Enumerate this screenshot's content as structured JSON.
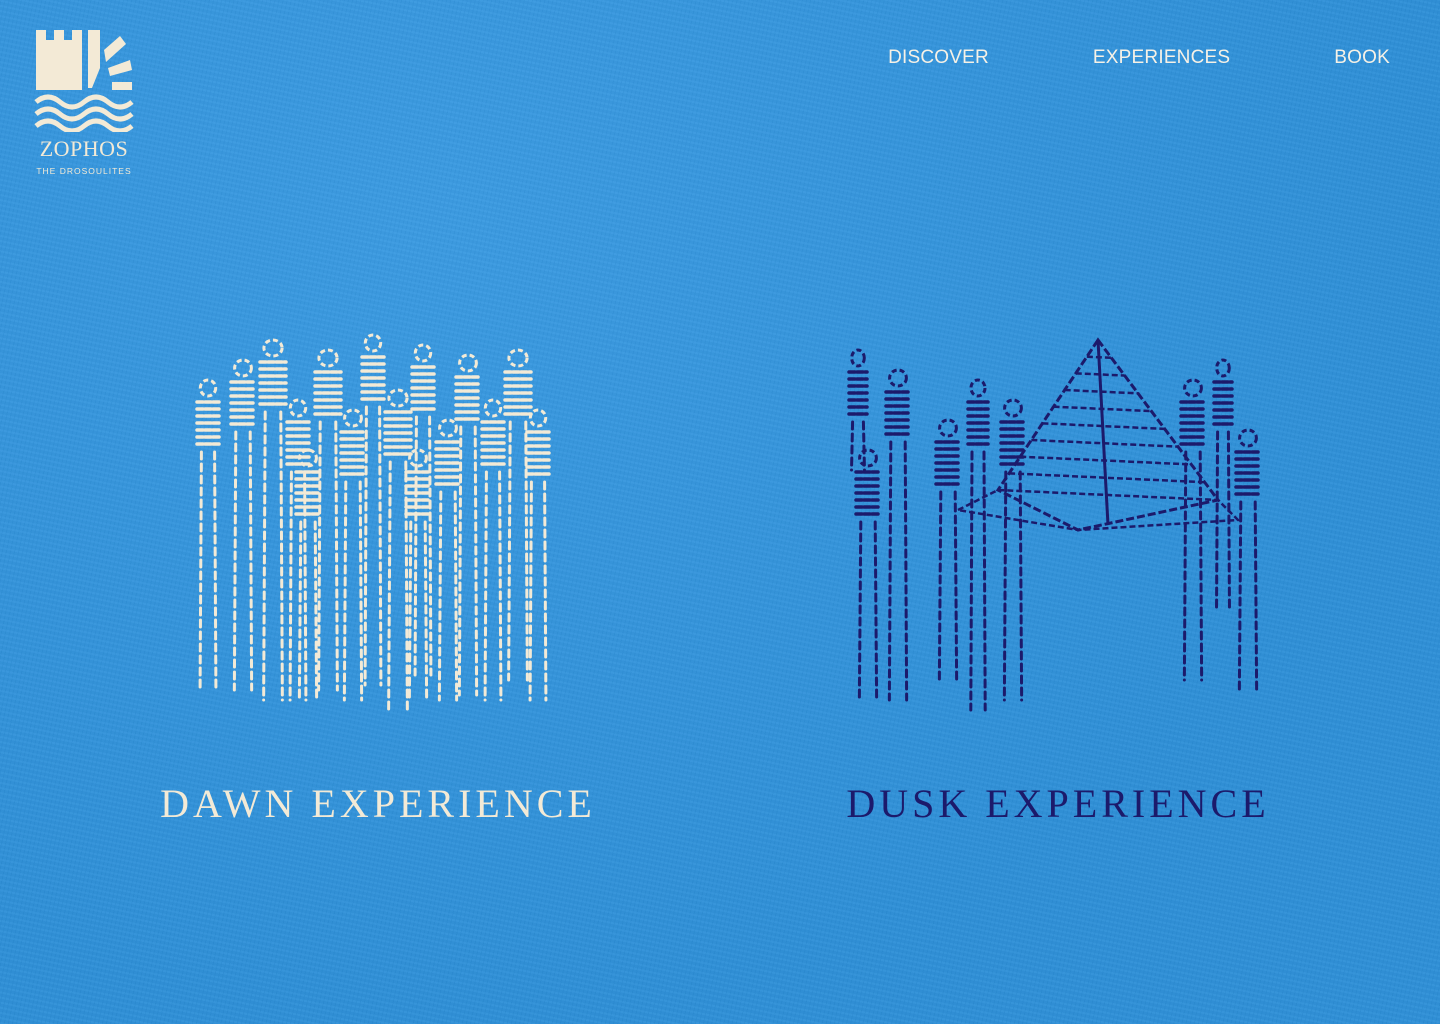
{
  "brand": {
    "name": "ZOPHOS",
    "subtitle": "THE DROSOULITES",
    "color": "#f3ead6",
    "icon": "castle-sun-wave-logo"
  },
  "nav": {
    "items": [
      {
        "label": "DISCOVER"
      },
      {
        "label": "EXPERIENCES"
      },
      {
        "label": "BOOK"
      }
    ]
  },
  "experiences": [
    {
      "title": "DAWN EXPERIENCE",
      "color": "#f3ead6",
      "illustration": "embroidered-procession-illustration"
    },
    {
      "title": "DUSK EXPERIENCE",
      "color": "#1c1a6b",
      "illustration": "embroidered-tent-figures-illustration"
    }
  ],
  "theme": {
    "background": "#2f95e0"
  }
}
